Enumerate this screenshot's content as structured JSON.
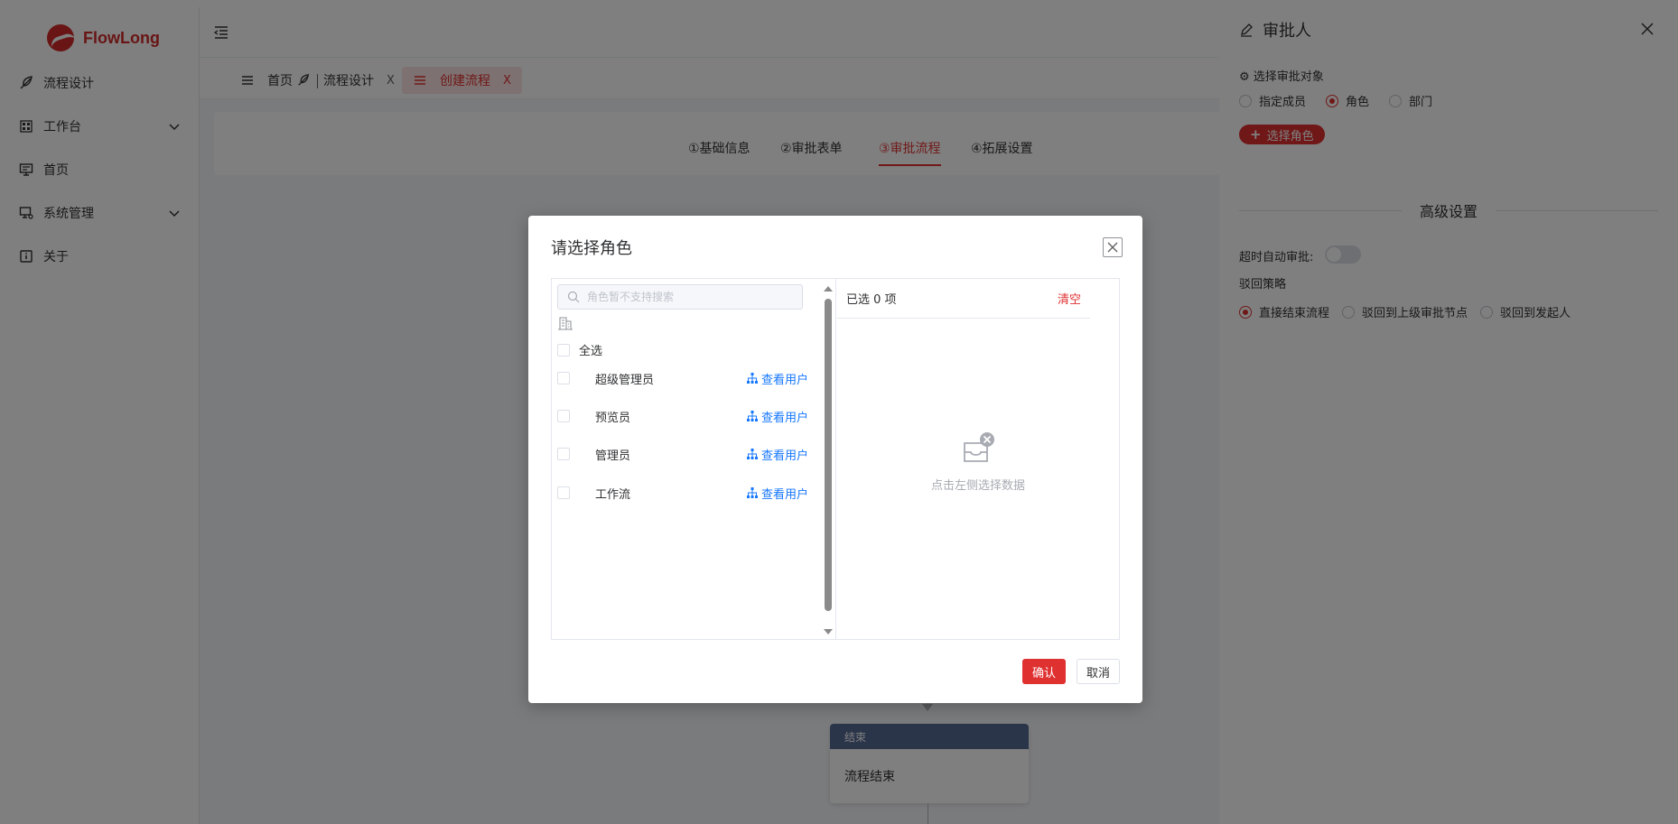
{
  "colors": {
    "accent": "#e03131",
    "link": "#1677ff",
    "overlay": "rgba(0,0,0,0.5)",
    "end_node_header": "#576a95"
  },
  "app": {
    "logo_text": "FlowLong"
  },
  "sidebar": {
    "items": [
      {
        "label": "流程设计",
        "icon": "feather-icon",
        "has_submenu": false
      },
      {
        "label": "工作台",
        "icon": "grid-icon",
        "has_submenu": true
      },
      {
        "label": "首页",
        "icon": "monitor-icon",
        "has_submenu": false
      },
      {
        "label": "系统管理",
        "icon": "monitor-settings-icon",
        "has_submenu": true
      },
      {
        "label": "关于",
        "icon": "info-icon",
        "has_submenu": false
      }
    ]
  },
  "tabs": [
    {
      "label": "首页",
      "icon": "menu-icon",
      "closable": false,
      "active": false
    },
    {
      "label": "流程设计",
      "icon": "feather-icon",
      "closable": true,
      "active": false
    },
    {
      "label": "创建流程",
      "icon": "menu-icon",
      "closable": true,
      "active": true
    }
  ],
  "tab_close_symbol": "X",
  "steps": [
    "①基础信息",
    "②审批表单",
    "③审批流程",
    "④拓展设置"
  ],
  "active_step": 2,
  "flow": {
    "end_node": {
      "header": "结束",
      "body": "流程结束"
    }
  },
  "right_panel": {
    "title": "审批人",
    "select_target_label": "⚙ 选择审批对象",
    "target_options": [
      "指定成员",
      "角色",
      "部门"
    ],
    "target_selected": "角色",
    "add_button": "选择角色",
    "advanced_title": "高级设置",
    "timeout_label": "超时自动审批:",
    "timeout_enabled": false,
    "reject_label": "驳回策略",
    "reject_options": [
      "直接结束流程",
      "驳回到上级审批节点",
      "驳回到发起人"
    ],
    "reject_selected": "直接结束流程"
  },
  "dialog": {
    "title": "请选择角色",
    "search_placeholder": "角色暂不支持搜索",
    "select_all": "全选",
    "view_users": "查看用户",
    "roles": [
      {
        "name": "超级管理员",
        "checked": false
      },
      {
        "name": "预览员",
        "checked": false
      },
      {
        "name": "管理员",
        "checked": false
      },
      {
        "name": "工作流",
        "checked": false
      }
    ],
    "selected_count_text": "已选 0 项",
    "clear": "清空",
    "empty_text": "点击左侧选择数据",
    "confirm": "确认",
    "cancel": "取消"
  }
}
